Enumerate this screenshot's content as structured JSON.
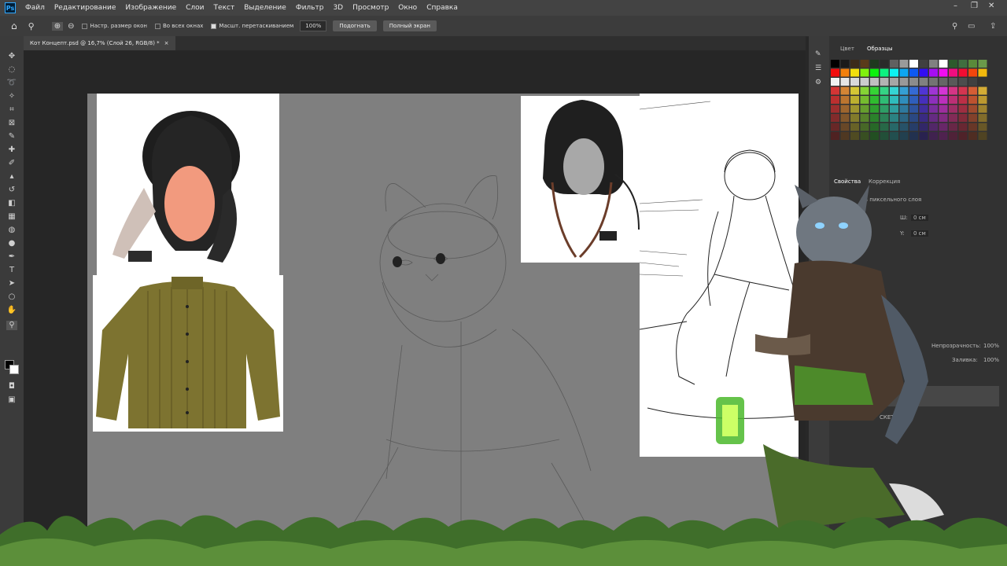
{
  "menu": {
    "logo": "Ps",
    "items": [
      "Файл",
      "Редактирование",
      "Изображение",
      "Слои",
      "Текст",
      "Выделение",
      "Фильтр",
      "3D",
      "Просмотр",
      "Окно",
      "Справка"
    ]
  },
  "window_controls": {
    "minimize": "–",
    "restore": "❐",
    "close": "✕"
  },
  "options": {
    "resize_windows": "Настр. размер окон",
    "all_windows": "Во всех окнах",
    "scrubby_zoom": "Масшт. перетаскиванием",
    "zoom_value": "100%",
    "fit_button": "Подогнать",
    "fullscreen_button": "Полный экран"
  },
  "document": {
    "tab_title": "Кот Концепт.psd @ 16,7% (Слой 26, RGB/8) *",
    "close": "×"
  },
  "panels": {
    "color_tab": "Цвет",
    "swatches_tab": "Образцы",
    "properties_tab": "Свойства",
    "adjustments_tab": "Коррекция",
    "pixel_layer_label": "Св пиксельного слоя",
    "w_label": "Ш:",
    "w_value": "0 см",
    "h_label": "Y:",
    "h_value": "0 см",
    "opacity_label": "Непрозрачность:",
    "opacity_value": "100%",
    "fill_label": "Заливка:",
    "fill_value": "100%",
    "layer_sketch": "СКЕТЧ"
  },
  "swatch_colors": {
    "row0": [
      "#000000",
      "#1a1a1a",
      "#3b2a1a",
      "#5a3a1a",
      "#1f3a1f",
      "#2a2a2a",
      "#606060",
      "#9a9a9a",
      "#ffffff",
      "#404040",
      "#808080",
      "#ffffff",
      "#2c5a2c",
      "#3f6e3f",
      "#5a8a3a",
      "#6a9a4a"
    ],
    "accent": "#31a8ff"
  }
}
